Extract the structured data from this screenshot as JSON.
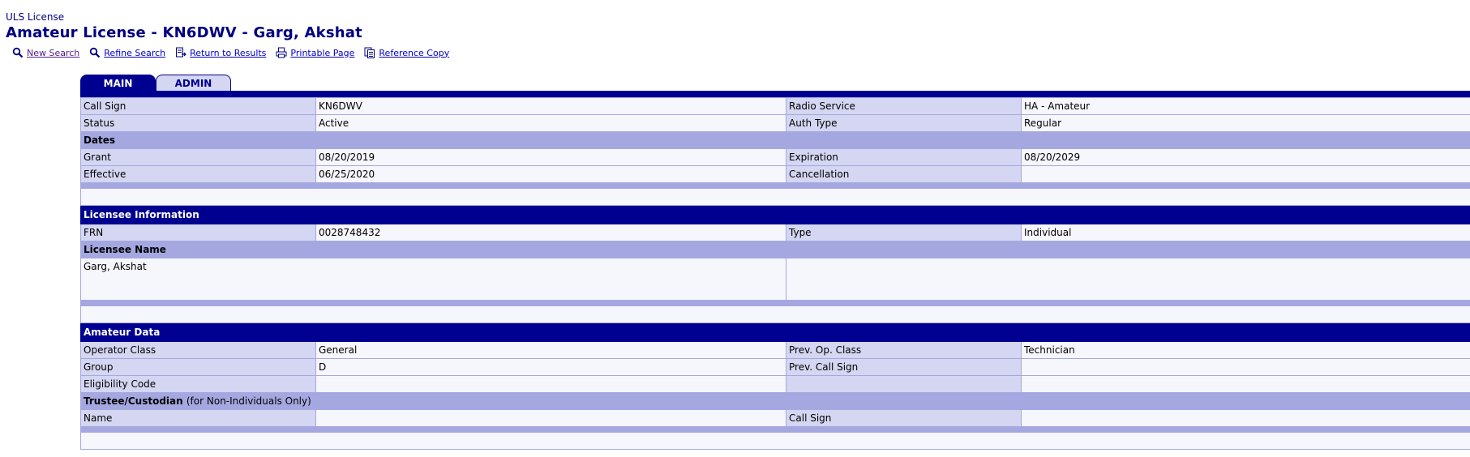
{
  "breadcrumb": "ULS License",
  "title": "Amateur License - KN6DWV - Garg, Akshat",
  "toolbar": {
    "new_search": "New Search",
    "refine_search": "Refine Search",
    "return_results": "Return to Results",
    "printable": "Printable Page",
    "reference": "Reference Copy"
  },
  "tabs": {
    "main": "MAIN",
    "admin": "ADMIN"
  },
  "main_info": {
    "call_sign_label": "Call Sign",
    "call_sign": "KN6DWV",
    "radio_service_label": "Radio Service",
    "radio_service": "HA - Amateur",
    "status_label": "Status",
    "status": "Active",
    "auth_type_label": "Auth Type",
    "auth_type": "Regular"
  },
  "dates": {
    "header": "Dates",
    "grant_label": "Grant",
    "grant": "08/20/2019",
    "expiration_label": "Expiration",
    "expiration": "08/20/2029",
    "effective_label": "Effective",
    "effective": "06/25/2020",
    "cancellation_label": "Cancellation",
    "cancellation": ""
  },
  "licensee": {
    "header": "Licensee Information",
    "frn_label": "FRN",
    "frn": "0028748432",
    "type_label": "Type",
    "type": "Individual",
    "name_header": "Licensee Name",
    "name": "Garg, Akshat"
  },
  "amateur": {
    "header": "Amateur Data",
    "op_class_label": "Operator Class",
    "op_class": "General",
    "prev_op_class_label": "Prev. Op. Class",
    "prev_op_class": "Technician",
    "group_label": "Group",
    "group": "D",
    "prev_call_label": "Prev. Call Sign",
    "prev_call": "",
    "eligibility_label": "Eligibility Code",
    "eligibility": "",
    "trustee_header": "Trustee/Custodian",
    "trustee_note": "(for Non-Individuals Only)",
    "name_label": "Name",
    "name": "",
    "call_sign_label": "Call Sign",
    "call_sign": ""
  }
}
